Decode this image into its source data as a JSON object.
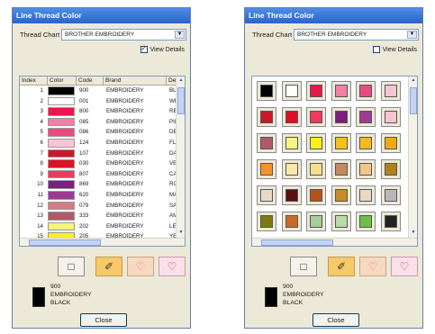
{
  "dialogs": [
    {
      "title": "Line Thread Color",
      "thread_chart_label": "Thread Chart",
      "thread_chart_value": "BROTHER EMBROIDERY",
      "view_details_label": "View Details",
      "view_details_checked": true,
      "view_details_mark": "✓",
      "view": "table",
      "columns": [
        "Index",
        "Color",
        "Code",
        "Brand",
        "Desc"
      ],
      "rows": [
        {
          "index": "1",
          "color": "#000000",
          "code": "900",
          "brand": "EMBROIDERY",
          "desc": "BLA"
        },
        {
          "index": "2",
          "color": "#ffffff",
          "code": "001",
          "brand": "EMBROIDERY",
          "desc": "WHI"
        },
        {
          "index": "3",
          "color": "#e8174e",
          "code": "800",
          "brand": "EMBROIDERY",
          "desc": "RED"
        },
        {
          "index": "4",
          "color": "#f37ea6",
          "code": "085",
          "brand": "EMBROIDERY",
          "desc": "PINK"
        },
        {
          "index": "5",
          "color": "#e94b80",
          "code": "086",
          "brand": "EMBROIDERY",
          "desc": "DEE"
        },
        {
          "index": "6",
          "color": "#f7c4d4",
          "code": "124",
          "brand": "EMBROIDERY",
          "desc": "FLES"
        },
        {
          "index": "7",
          "color": "#c8182c",
          "code": "107",
          "brand": "EMBROIDERY",
          "desc": "DAR"
        },
        {
          "index": "8",
          "color": "#e01024",
          "code": "030",
          "brand": "EMBROIDERY",
          "desc": "VER"
        },
        {
          "index": "9",
          "color": "#ee3a62",
          "code": "807",
          "brand": "EMBROIDERY",
          "desc": "CAR"
        },
        {
          "index": "10",
          "color": "#7c1d80",
          "code": "869",
          "brand": "EMBROIDERY",
          "desc": "ROY"
        },
        {
          "index": "11",
          "color": "#9c3a92",
          "code": "620",
          "brand": "EMBROIDERY",
          "desc": "MAG"
        },
        {
          "index": "12",
          "color": "#d17c86",
          "code": "079",
          "brand": "EMBROIDERY",
          "desc": "SAL"
        },
        {
          "index": "13",
          "color": "#b3586a",
          "code": "333",
          "brand": "EMBROIDERY",
          "desc": "AME"
        },
        {
          "index": "14",
          "color": "#f4f57a",
          "code": "202",
          "brand": "EMBROIDERY",
          "desc": "LEM"
        },
        {
          "index": "15",
          "color": "#f8f21b",
          "code": "205",
          "brand": "EMBROIDERY",
          "desc": "YEL"
        }
      ],
      "buttons": [
        {
          "name": "rectangle-tool-button",
          "glyph": "□",
          "style": ""
        },
        {
          "name": "pick-color-button",
          "glyph": "✐",
          "style": "orange"
        },
        {
          "name": "heart-outline-button",
          "glyph": "♡",
          "style": "peach"
        },
        {
          "name": "heart-button",
          "glyph": "♡",
          "style": "pink"
        }
      ],
      "selected": {
        "code": "900",
        "brand": "EMBROIDERY",
        "desc": "BLACK",
        "color": "#000000"
      },
      "close_label": "Close"
    },
    {
      "title": "Line Thread Color",
      "thread_chart_label": "Thread Chart",
      "thread_chart_value": "BROTHER EMBROIDERY",
      "view_details_label": "View Details",
      "view_details_checked": false,
      "view_details_mark": "",
      "view": "grid",
      "swatches": [
        "#000000",
        "#ffffff",
        "#e8174e",
        "#f37ea6",
        "#e94b80",
        "#f7c4d4",
        "#c8182c",
        "#e01024",
        "#ee3a62",
        "#7c1d80",
        "#9c3a92",
        "#f7c4d4",
        "#b3586a",
        "#f4f57a",
        "#f8f21b",
        "#f6c21a",
        "#f9b81a",
        "#f0a812",
        "#f3922a",
        "#f9e9a8",
        "#f4e08a",
        "#c38a5a",
        "#f6c58a",
        "#b1811b",
        "#ead8c6",
        "#5a0f0f",
        "#b6531a",
        "#c98a2a",
        "#ead8c6",
        "#b9b8b8",
        "#7e7a12",
        "#c86a28",
        "#a5cf9a",
        "#b8dca8",
        "#6cc04a",
        "#222222"
      ],
      "buttons": [
        {
          "name": "rectangle-tool-button",
          "glyph": "□",
          "style": ""
        },
        {
          "name": "pick-color-button",
          "glyph": "✐",
          "style": "orange"
        },
        {
          "name": "heart-outline-button",
          "glyph": "♡",
          "style": "peach"
        },
        {
          "name": "heart-button",
          "glyph": "♡",
          "style": "pink"
        }
      ],
      "selected": {
        "code": "900",
        "brand": "EMBROIDERY",
        "desc": "BLACK",
        "color": "#000000"
      },
      "close_label": "Close"
    }
  ]
}
